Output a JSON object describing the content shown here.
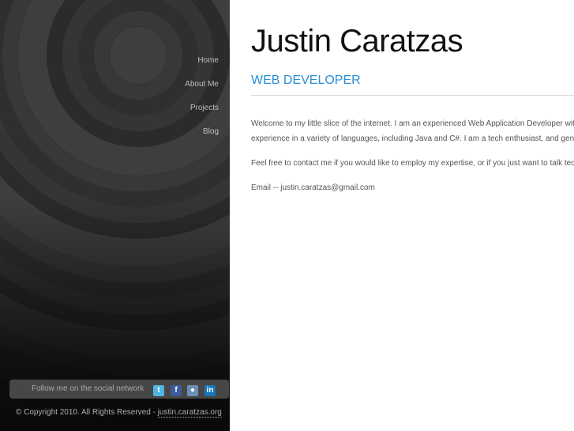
{
  "nav": [
    "Home",
    "About Me",
    "Projects",
    "Blog"
  ],
  "social": {
    "label": "Follow me on the social network",
    "icons": [
      "twitter-icon",
      "facebook-icon",
      "reddit-icon",
      "linkedin-icon"
    ]
  },
  "footer": {
    "copyright": "© Copyright 2010. All Rights Reserved - ",
    "link": "justin.caratzas.org"
  },
  "header": {
    "name": "Justin Caratzas",
    "title": "WEB DEVELOPER"
  },
  "content": {
    "intro_line1": "Welcome to my little slice of the internet. I am an experienced Web Application Developer with",
    "intro_line2": "experience in a variety of languages, including Java and C#. I am a tech enthusiast, and gene",
    "contact": "Feel free to contact me if you would like to employ my expertise, or if you just want to talk tech",
    "email": "Email -- justin.caratzas@gmail.com"
  },
  "colors": {
    "accent": "#2a8fd6",
    "sidebar": "#2f2f2f"
  }
}
